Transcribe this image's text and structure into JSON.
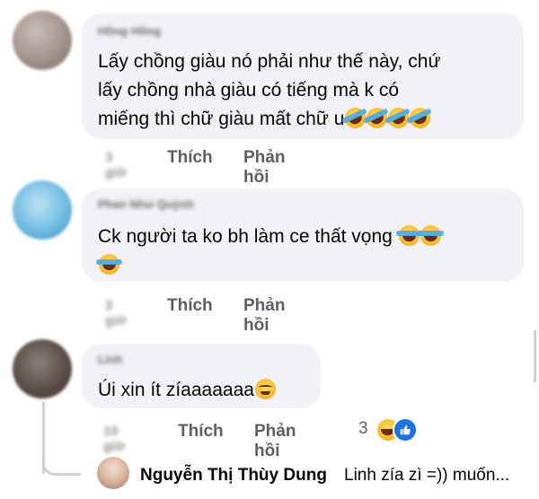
{
  "comments": [
    {
      "author": "Hồng Hồng",
      "lines": [
        "Lấy chồng giàu nó phải như thế này, chứ",
        "lấy chồng nhà giàu có tiếng mà k có",
        "miếng thì chữ giàu mất chữ u"
      ],
      "time": "3 giờ",
      "like_label": "Thích",
      "reply_label": "Phản hồi"
    },
    {
      "author": "Phan Như Quỳnh",
      "lines": [
        "Ck người ta ko bh làm ce thất vọng"
      ],
      "time": "3 giờ",
      "like_label": "Thích",
      "reply_label": "Phản hồi"
    },
    {
      "author": "Linh",
      "lines": [
        "Úi xin ít zíaaaaaaa"
      ],
      "time": "10 giờ",
      "like_label": "Thích",
      "reply_label": "Phản hồi",
      "reaction_count": "3"
    }
  ],
  "reply_preview": {
    "author": "Nguyễn Thị Thùy Dung",
    "text": "Linh  zía zì =)) muốn..."
  },
  "icons": {
    "emoji_laugh": "rolling-laughing-emoji",
    "emoji_joy": "tears-of-joy-emoji",
    "emoji_relieved": "relieved-face-emoji",
    "reaction_haha": "haha-reaction-icon",
    "reaction_like": "like-reaction-icon"
  },
  "colors": {
    "bubble": "#f0f2f5",
    "action_text": "#5b5e63",
    "like_blue": "#1b74e4"
  }
}
